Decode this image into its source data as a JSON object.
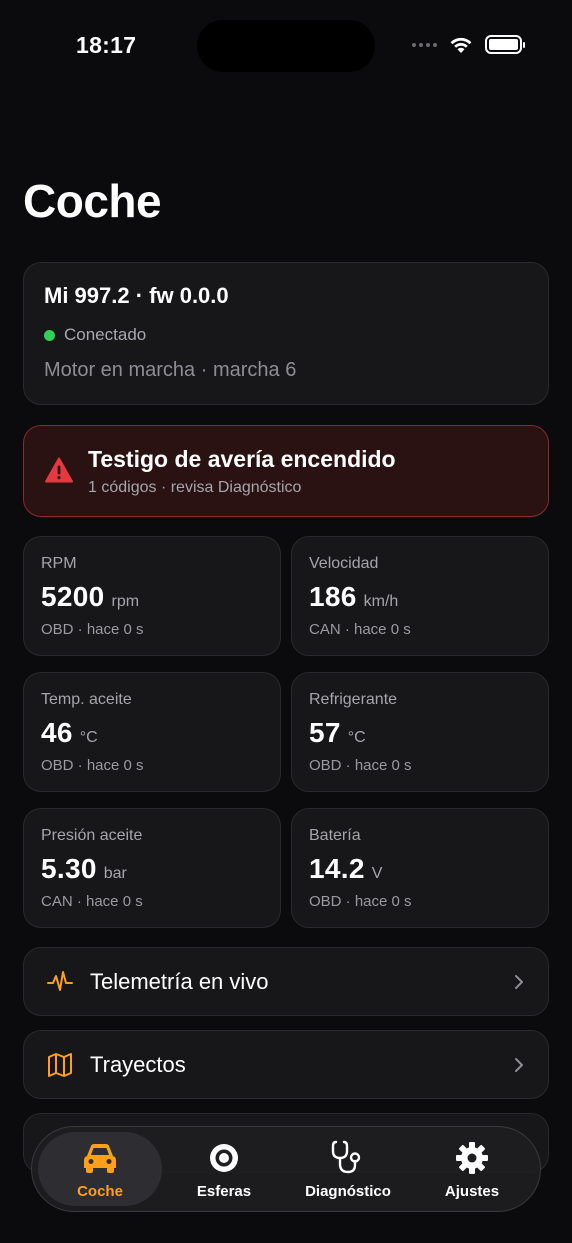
{
  "status_bar": {
    "time": "18:17"
  },
  "page": {
    "title": "Coche"
  },
  "vehicle": {
    "name": "Mi 997.2 · fw 0.0.0",
    "connection": "Conectado",
    "engine_status": "Motor en marcha · marcha 6"
  },
  "alert": {
    "title": "Testigo de avería encendido",
    "subtitle": "1 códigos · revisa Diagnóstico",
    "color": "#e5393f"
  },
  "metrics": [
    {
      "label": "RPM",
      "value": "5200",
      "unit": "rpm",
      "source": "OBD · hace 0 s"
    },
    {
      "label": "Velocidad",
      "value": "186",
      "unit": "km/h",
      "source": "CAN · hace 0 s"
    },
    {
      "label": "Temp. aceite",
      "value": "46",
      "unit": "°C",
      "source": "OBD · hace 0 s"
    },
    {
      "label": "Refrigerante",
      "value": "57",
      "unit": "°C",
      "source": "OBD · hace 0 s"
    },
    {
      "label": "Presión aceite",
      "value": "5.30",
      "unit": "bar",
      "source": "CAN · hace 0 s"
    },
    {
      "label": "Batería",
      "value": "14.2",
      "unit": "V",
      "source": "OBD · hace 0 s"
    }
  ],
  "nav_rows": [
    {
      "label": "Telemetría en vivo",
      "icon": "pulse-icon"
    },
    {
      "label": "Trayectos",
      "icon": "map-icon"
    }
  ],
  "tabs": [
    {
      "label": "Coche",
      "icon": "car-icon",
      "active": true
    },
    {
      "label": "Esferas",
      "icon": "gauge-icon",
      "active": false
    },
    {
      "label": "Diagnóstico",
      "icon": "stethoscope-icon",
      "active": false
    },
    {
      "label": "Ajustes",
      "icon": "gear-icon",
      "active": false
    }
  ],
  "colors": {
    "accent": "#ff9f1a",
    "connected": "#30d158",
    "alert_bg": "#2a1213"
  }
}
